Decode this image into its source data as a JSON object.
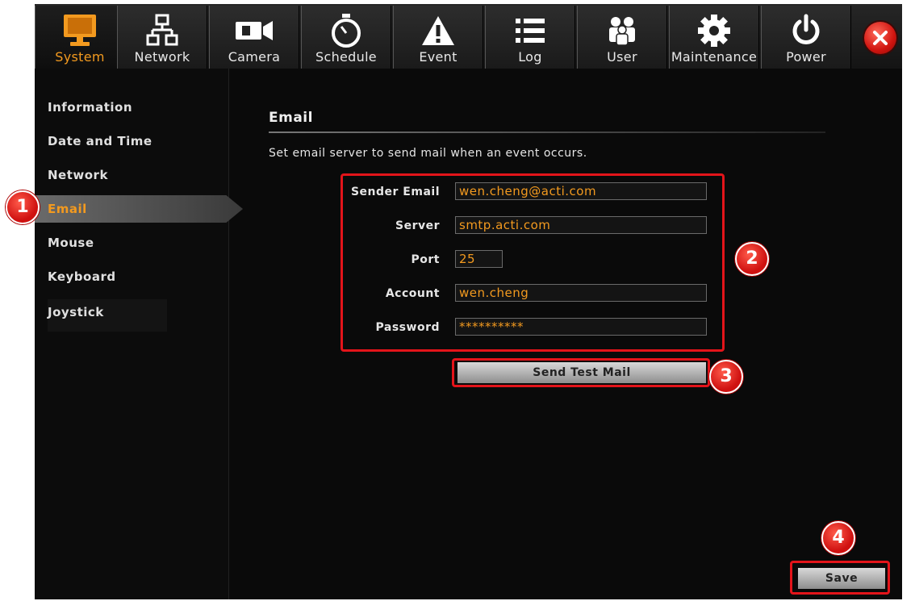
{
  "toolbar": {
    "tabs": [
      {
        "label": "System",
        "icon": "monitor-icon",
        "active": true
      },
      {
        "label": "Network",
        "icon": "network-icon",
        "active": false
      },
      {
        "label": "Camera",
        "icon": "camera-icon",
        "active": false
      },
      {
        "label": "Schedule",
        "icon": "stopwatch-icon",
        "active": false
      },
      {
        "label": "Event",
        "icon": "warning-icon",
        "active": false
      },
      {
        "label": "Log",
        "icon": "list-icon",
        "active": false
      },
      {
        "label": "User",
        "icon": "users-icon",
        "active": false
      },
      {
        "label": "Maintenance",
        "icon": "gear-icon",
        "active": false
      },
      {
        "label": "Power",
        "icon": "power-icon",
        "active": false
      }
    ],
    "close_icon": "close-icon"
  },
  "sidebar": {
    "items": [
      {
        "label": "Information",
        "active": false
      },
      {
        "label": "Date and Time",
        "active": false
      },
      {
        "label": "Network",
        "active": false
      },
      {
        "label": "Email",
        "active": true
      },
      {
        "label": "Mouse",
        "active": false
      },
      {
        "label": "Keyboard",
        "active": false
      },
      {
        "label": "Joystick",
        "active": false
      }
    ]
  },
  "email": {
    "title": "Email",
    "description": "Set email server to send mail when an event occurs.",
    "fields": [
      {
        "label": "Sender Email",
        "value": "wen.cheng@acti.com"
      },
      {
        "label": "Server",
        "value": "smtp.acti.com"
      },
      {
        "label": "Port",
        "value": "25"
      },
      {
        "label": "Account",
        "value": "wen.cheng"
      },
      {
        "label": "Password",
        "value": "**********"
      }
    ],
    "test_button": "Send Test Mail",
    "save_button": "Save"
  },
  "callouts": [
    "1",
    "2",
    "3",
    "4"
  ],
  "colors": {
    "accent": "#f39a1f",
    "highlight": "#e3141a",
    "background": "#0a0a0a"
  }
}
